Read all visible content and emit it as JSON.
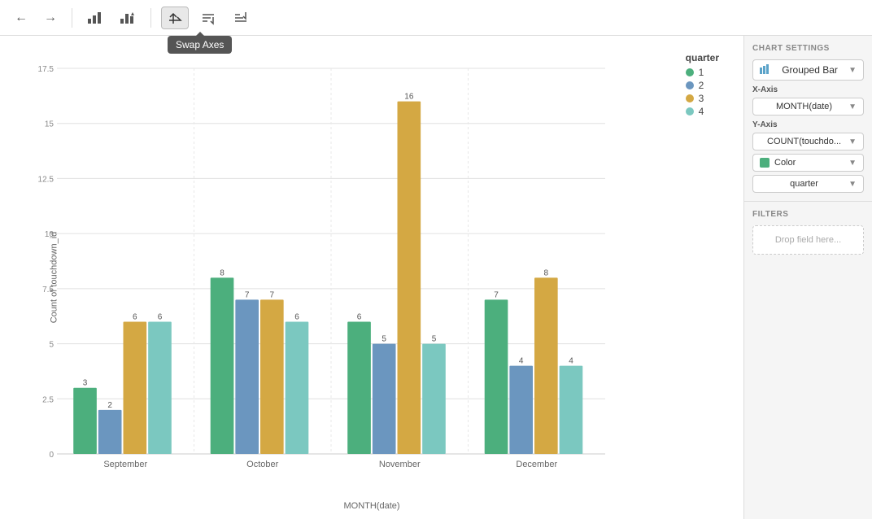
{
  "toolbar": {
    "back_label": "←",
    "forward_label": "→",
    "swap_axes_tooltip": "Swap Axes"
  },
  "chart": {
    "y_axis_label": "Count of touchdown_id",
    "x_axis_label": "MONTH(date)",
    "legend_title": "quarter",
    "legend_items": [
      {
        "label": "1",
        "color": "#4caf7d"
      },
      {
        "label": "2",
        "color": "#6b96bf"
      },
      {
        "label": "3",
        "color": "#d4a843"
      },
      {
        "label": "4",
        "color": "#7bc8c0"
      }
    ],
    "y_ticks": [
      "0",
      "2.5",
      "5",
      "7.5",
      "10",
      "12.5",
      "15",
      "17.5"
    ],
    "months": [
      "September",
      "October",
      "November",
      "December"
    ],
    "data": {
      "September": {
        "q1": 3,
        "q2": 2,
        "q3": 6,
        "q4": 6
      },
      "October": {
        "q1": 8,
        "q2": 7,
        "q3": 7,
        "q4": 6
      },
      "November": {
        "q1": 6,
        "q2": 5,
        "q3": 16,
        "q4": 5
      },
      "December": {
        "q1": 7,
        "q2": 4,
        "q3": 8,
        "q4": 4
      }
    },
    "max_y": 17.5
  },
  "panel": {
    "title": "CHART SETTINGS",
    "chart_type_icon": "▦",
    "chart_type_label": "Grouped Bar",
    "x_axis_label": "X-Axis",
    "x_axis_value": "MONTH(date)",
    "y_axis_label": "Y-Axis",
    "y_axis_value": "COUNT(touchdo...",
    "color_label": "Color",
    "color_value": "quarter",
    "filters_label": "FILTERS",
    "drop_field_placeholder": "Drop field here..."
  }
}
